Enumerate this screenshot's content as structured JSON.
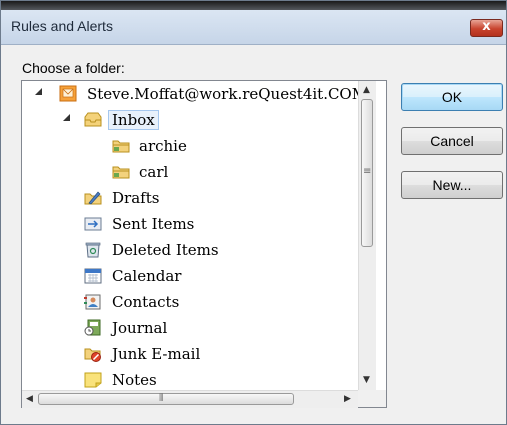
{
  "window": {
    "title": "Rules and Alerts",
    "close_glyph": "x"
  },
  "prompt": "Choose a folder:",
  "tree": {
    "items": [
      {
        "label": "Steve.Moffat@work.reQuest4it.COM",
        "icon": "mailbox-icon",
        "depth": 0,
        "expanded": true
      },
      {
        "label": "Inbox",
        "icon": "inbox-icon",
        "depth": 1,
        "expanded": true,
        "selected": true
      },
      {
        "label": "archie",
        "icon": "folder-icon",
        "depth": 2
      },
      {
        "label": "carl",
        "icon": "folder-icon",
        "depth": 2
      },
      {
        "label": "Drafts",
        "icon": "drafts-icon",
        "depth": 1
      },
      {
        "label": "Sent Items",
        "icon": "sent-items-icon",
        "depth": 1
      },
      {
        "label": "Deleted Items",
        "icon": "deleted-items-icon",
        "depth": 1
      },
      {
        "label": "Calendar",
        "icon": "calendar-icon",
        "depth": 1
      },
      {
        "label": "Contacts",
        "icon": "contacts-icon",
        "depth": 1
      },
      {
        "label": "Journal",
        "icon": "journal-icon",
        "depth": 1
      },
      {
        "label": "Junk E-mail",
        "icon": "junk-email-icon",
        "depth": 1
      },
      {
        "label": "Notes",
        "icon": "notes-icon",
        "depth": 1
      }
    ]
  },
  "buttons": {
    "ok": "OK",
    "cancel": "Cancel",
    "new": "New..."
  },
  "colors": {
    "title_bar": "#c6d5e8",
    "close_button": "#c8442e",
    "selection": "#e8f1fb"
  }
}
